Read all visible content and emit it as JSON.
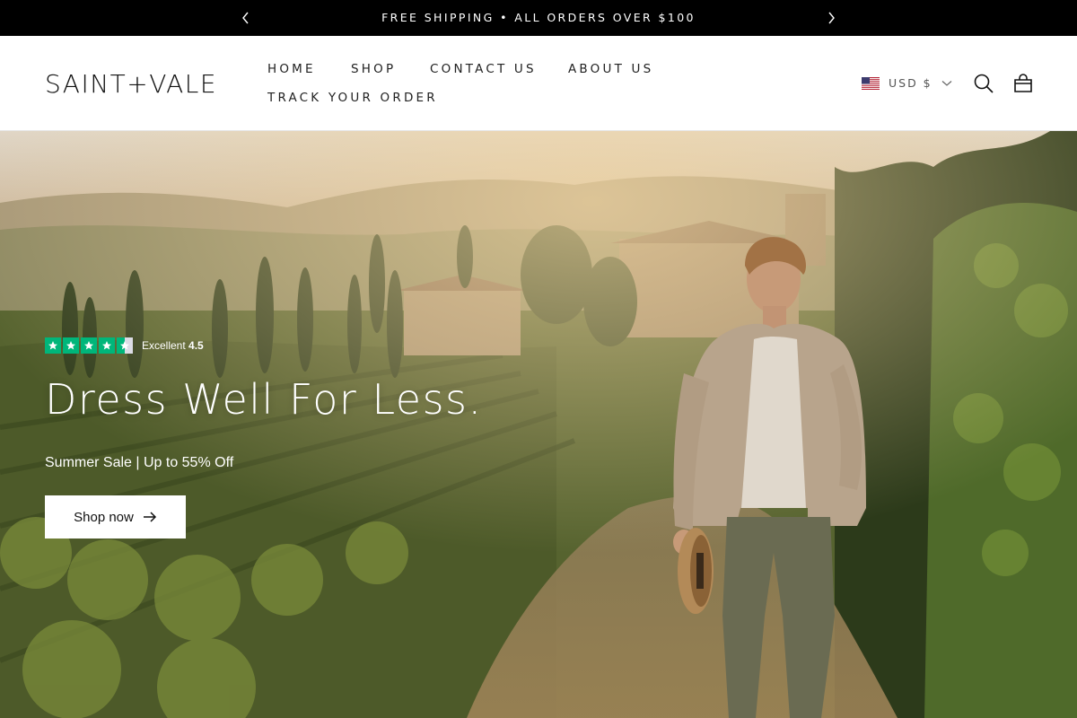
{
  "announcement": {
    "message": "FREE SHIPPING • ALL ORDERS OVER $100",
    "prev_icon": "chevron-left-icon",
    "next_icon": "chevron-right-icon"
  },
  "header": {
    "logo": "SAINT+VALE",
    "nav": {
      "home": "HOME",
      "shop": "SHOP",
      "contact": "CONTACT US",
      "about": "ABOUT US",
      "track": "TRACK YOUR ORDER"
    },
    "currency": {
      "label": "USD $",
      "flag_icon": "us-flag-icon"
    },
    "icons": {
      "search": "search-icon",
      "cart": "shopping-bag-icon"
    }
  },
  "hero": {
    "rating": {
      "label": "Excellent",
      "score": "4.5",
      "stars": 4.5,
      "star_color": "#00b67a"
    },
    "headline": "Dress Well For Less.",
    "subheadline": "Summer Sale | Up to 55% Off",
    "cta": {
      "label": "Shop now",
      "icon": "arrow-right-icon"
    }
  },
  "colors": {
    "announcement_bg": "#000000",
    "header_bg": "#ffffff",
    "cta_bg": "#ffffff",
    "text_dark": "#111111"
  }
}
